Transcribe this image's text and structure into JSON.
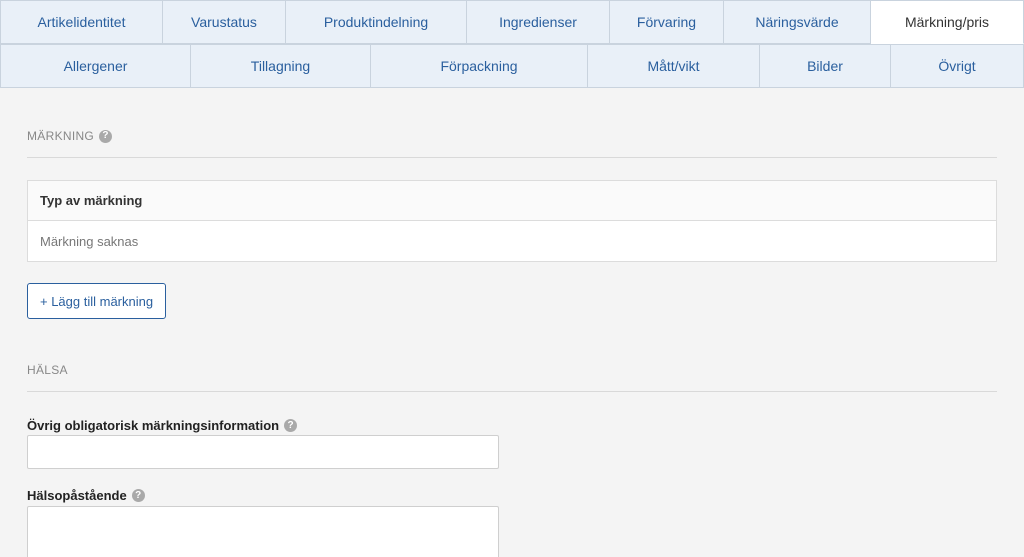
{
  "tabs": {
    "row1": [
      {
        "label": "Artikelidentitet",
        "active": false
      },
      {
        "label": "Varustatus",
        "active": false
      },
      {
        "label": "Produktindelning",
        "active": false
      },
      {
        "label": "Ingredienser",
        "active": false
      },
      {
        "label": "Förvaring",
        "active": false
      },
      {
        "label": "Näringsvärde",
        "active": false
      },
      {
        "label": "Märkning/pris",
        "active": true
      }
    ],
    "row2": [
      {
        "label": "Allergener"
      },
      {
        "label": "Tillagning"
      },
      {
        "label": "Förpackning"
      },
      {
        "label": "Mått/vikt"
      },
      {
        "label": "Bilder"
      },
      {
        "label": "Övrigt"
      }
    ]
  },
  "marking": {
    "section_title": "MÄRKNING",
    "table_header": "Typ av märkning",
    "empty_text": "Märkning saknas",
    "add_button_label": "+ Lägg till märkning"
  },
  "health": {
    "section_title": "HÄLSA",
    "other_info_label": "Övrig obligatorisk märkningsinformation",
    "other_info_value": "",
    "health_claim_label": "Hälsopåstående",
    "health_claim_value": ""
  },
  "colors": {
    "accent": "#2a5f9e",
    "tab_bg": "#e9f0f8",
    "page_bg": "#f4f4f4"
  },
  "icons": {
    "help": "question-circle-icon"
  }
}
